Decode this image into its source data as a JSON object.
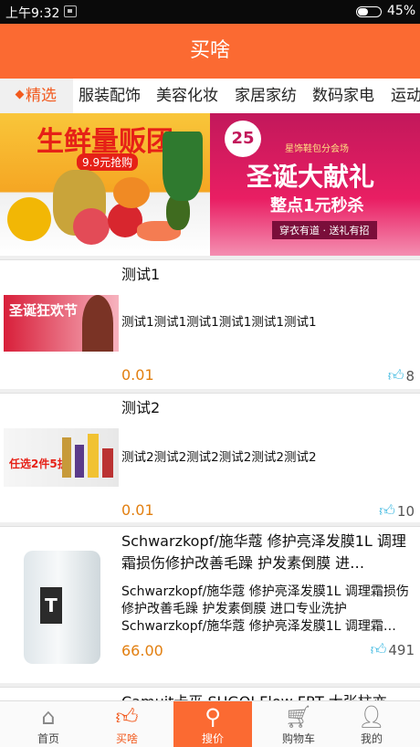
{
  "status": {
    "time": "上午9:32",
    "battery": "45%"
  },
  "app": {
    "title": "买啥"
  },
  "tabs": [
    "精选",
    "服装配饰",
    "美容化妆",
    "家居家纺",
    "数码家电",
    "运动"
  ],
  "banners": [
    {
      "headline": "生鲜量贩团",
      "sub": "9.9元抢购"
    },
    {
      "logo": "25",
      "small": "星饰鞋包分会场",
      "headline": "圣诞大献礼",
      "sub": "整点1元秒杀",
      "sub2": "穿衣有道 · 送礼有招"
    }
  ],
  "products": [
    {
      "title": "测试1",
      "desc": "测试1测试1测试1测试1测试1测试1",
      "thumb_text": "圣诞狂欢节",
      "price": "0.01",
      "likes": "8"
    },
    {
      "title": "测试2",
      "desc": "测试2测试2测试2测试2测试2测试2",
      "thumb_text": "任选2件5折",
      "price": "0.01",
      "likes": "10"
    },
    {
      "title": "Schwarzkopf/施华蔻 修护亮泽发膜1L 调理霜损伤修护改善毛躁 护发素倒膜 进…",
      "desc": "Schwarzkopf/施华蔻 修护亮泽发膜1L 调理霜损伤修护改善毛躁 护发素倒膜 进口专业洗护Schwarzkopf/施华蔻 修护亮泽发膜1L 调理霜…",
      "thumb_text": "T",
      "price": "66.00",
      "likes": "491"
    },
    {
      "title": "Camuit卡巫 SUGOI Flow FRT 大张柱亦舞…"
    }
  ],
  "nav": [
    {
      "label": "首页",
      "icon": "home-icon"
    },
    {
      "label": "买啥",
      "icon": "thumbs-up-icon"
    },
    {
      "label": "搜价",
      "icon": "search-icon"
    },
    {
      "label": "购物车",
      "icon": "cart-icon"
    },
    {
      "label": "我的",
      "icon": "user-icon"
    }
  ],
  "colors": {
    "brand": "#fb6a32",
    "price": "#e27f10",
    "like": "#3cb8e0"
  }
}
